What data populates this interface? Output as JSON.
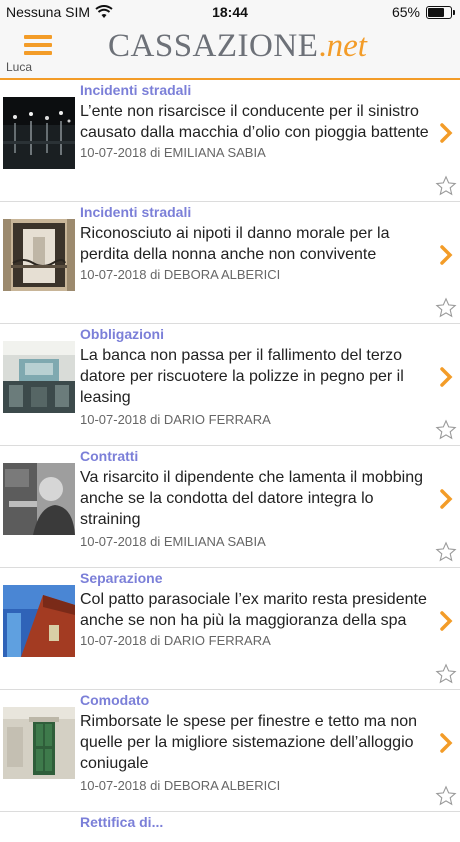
{
  "status_bar": {
    "carrier": "Nessuna SIM",
    "time": "18:44",
    "battery": "65%"
  },
  "header": {
    "logo_brand": "CASSAZIONE",
    "logo_dot": ".",
    "logo_tld": "net",
    "user_name": "Luca"
  },
  "articles": [
    {
      "category": "Incidenti stradali",
      "title": "L’ente non risarcisce il conducente per il sinistro causato dalla macchia d’olio con pioggia battente",
      "date": "10-07-2018",
      "by": "di",
      "author": "EMILIANA SABIA"
    },
    {
      "category": "Incidenti stradali",
      "title": "Riconosciuto ai nipoti il danno morale per la perdita della nonna anche non convivente",
      "date": "10-07-2018",
      "by": "di",
      "author": "DEBORA ALBERICI"
    },
    {
      "category": "Obbligazioni",
      "title": "La banca non passa per il fallimento del terzo datore per riscuotere la polizze in pegno per il leasing",
      "date": "10-07-2018",
      "by": "di",
      "author": "DARIO FERRARA"
    },
    {
      "category": "Contratti",
      "title": "Va risarcito il dipendente che lamenta il mobbing anche se la condotta del datore integra lo straining",
      "date": "10-07-2018",
      "by": "di",
      "author": "EMILIANA SABIA"
    },
    {
      "category": "Separazione",
      "title": "Col patto parasociale l’ex marito resta presidente anche se non ha più la maggioranza della spa",
      "date": "10-07-2018",
      "by": "di",
      "author": "DARIO FERRARA"
    },
    {
      "category": "Comodato",
      "title": "Rimborsate le spese per finestre e tetto ma non quelle per la migliore sistemazione dell’alloggio coniugale",
      "date": "10-07-2018",
      "by": "di",
      "author": "DEBORA ALBERICI"
    }
  ],
  "partial_article": {
    "category": "Rettifica di..."
  },
  "colors": {
    "accent": "#f39c28",
    "category": "#7b7fd8",
    "header_bg": "#f7f7f7"
  }
}
